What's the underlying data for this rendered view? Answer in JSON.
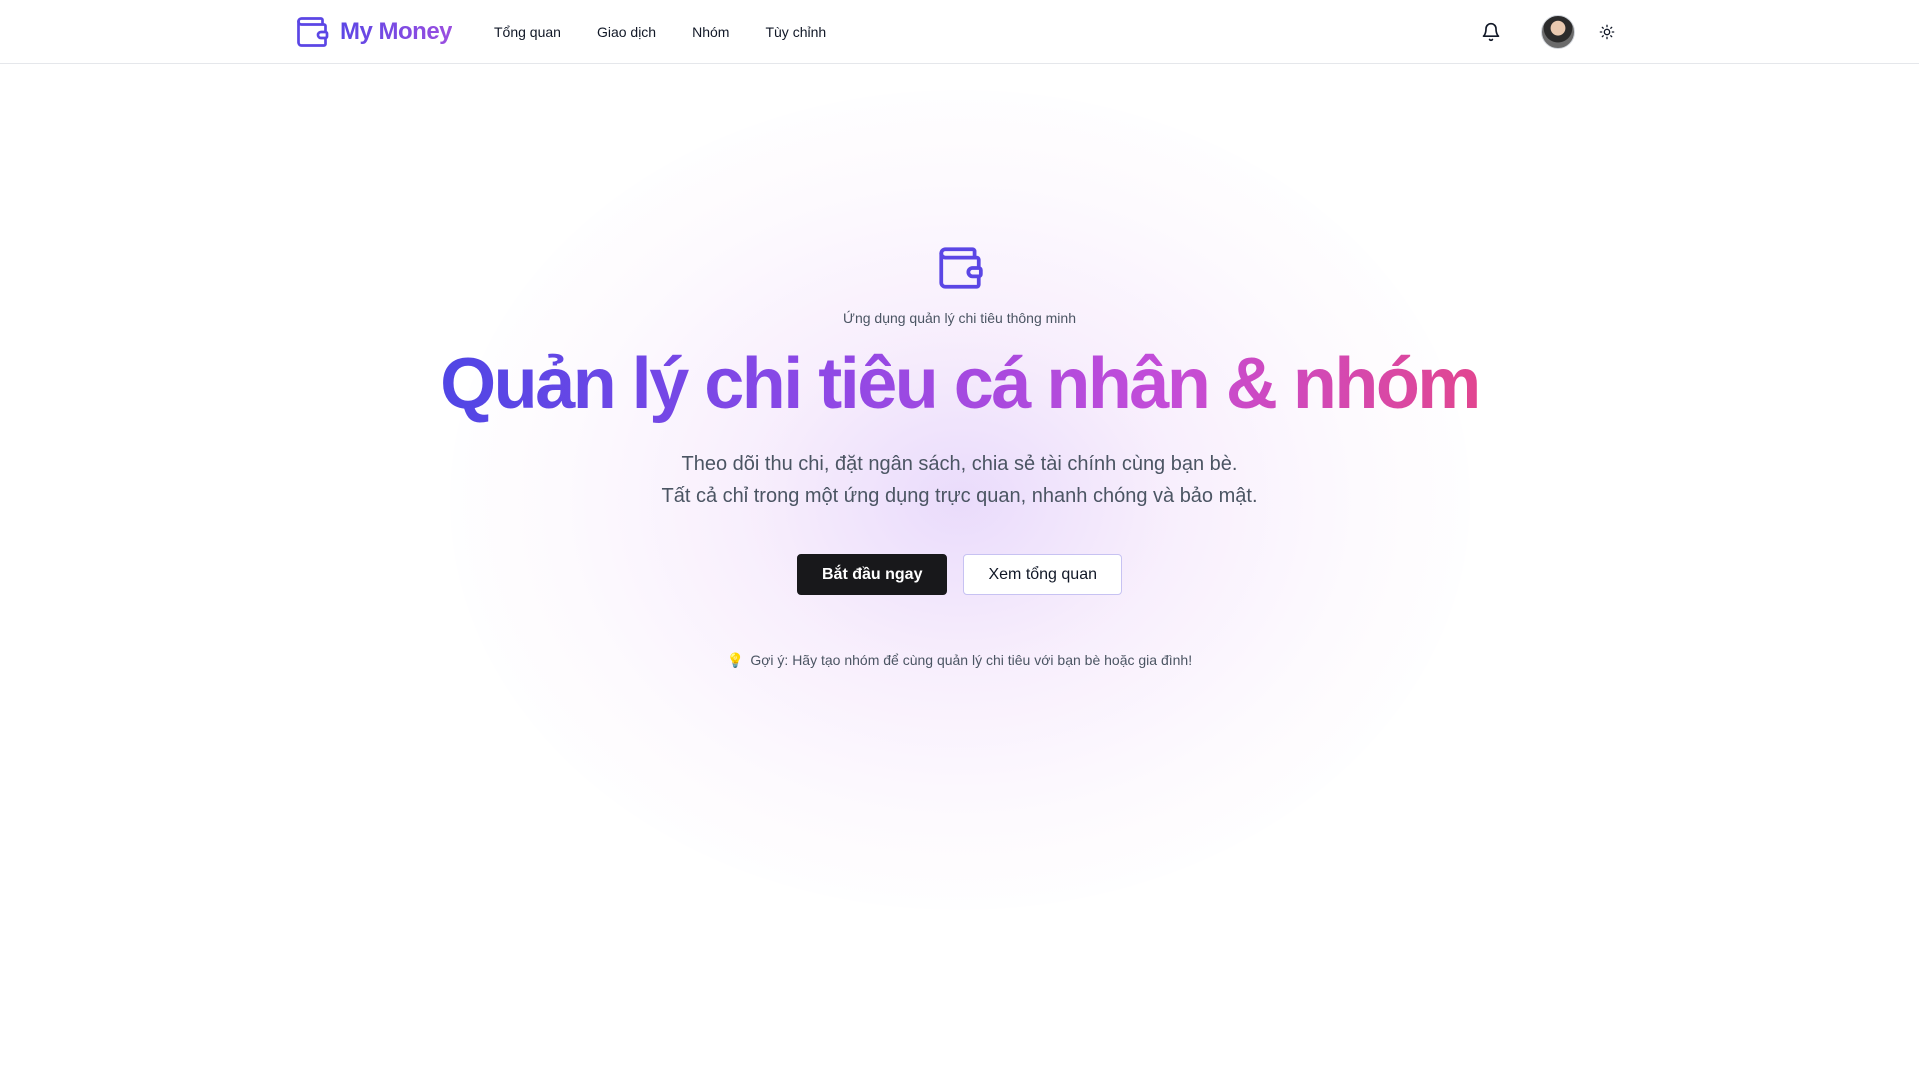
{
  "brand": {
    "name": "My Money",
    "logo_icon": "wallet-icon",
    "accent_colors": [
      "#4f46e5",
      "#8b48e6",
      "#c44cd8",
      "#e2468f"
    ]
  },
  "nav": {
    "items": [
      {
        "label": "Tổng quan"
      },
      {
        "label": "Giao dịch"
      },
      {
        "label": "Nhóm"
      },
      {
        "label": "Tùy chỉnh"
      }
    ]
  },
  "header_actions": {
    "notification_icon": "bell-icon",
    "avatar": "user-avatar",
    "theme_icon": "sun-icon"
  },
  "hero": {
    "icon": "wallet-icon",
    "eyebrow": "Ứng dụng quản lý chi tiêu thông minh",
    "title": "Quản lý chi tiêu cá nhân & nhóm",
    "subtitle_line1": "Theo dõi thu chi, đặt ngân sách, chia sẻ tài chính cùng bạn bè.",
    "subtitle_line2": "Tất cả chỉ trong một ứng dụng trực quan, nhanh chóng và bảo mật.",
    "primary_button": "Bắt đầu ngay",
    "secondary_button": "Xem tổng quan",
    "hint_icon": "💡",
    "hint": "Gợi ý: Hãy tạo nhóm để cùng quản lý chi tiêu với bạn bè hoặc gia đình!"
  }
}
